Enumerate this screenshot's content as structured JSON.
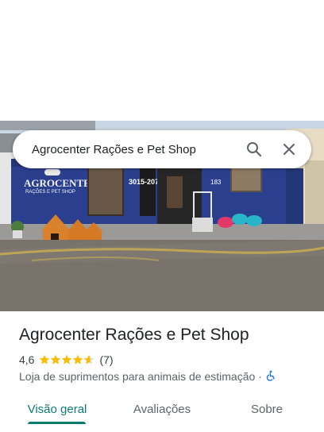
{
  "search": {
    "query": "Agrocenter Rações e Pet Shop"
  },
  "storefront": {
    "sign_brand": "AGROCENTER",
    "sign_sub": "RAÇÕES E PET SHOP",
    "phone": "3015-2074",
    "number": "183"
  },
  "place": {
    "name": "Agrocenter Rações e Pet Shop",
    "rating": "4,6",
    "rating_value": 4.6,
    "reviews_count": "(7)",
    "category": "Loja de suprimentos para animais de estimação",
    "separator": "·"
  },
  "tabs": [
    {
      "label": "Visão geral",
      "active": true
    },
    {
      "label": "Avaliações",
      "active": false
    },
    {
      "label": "Sobre",
      "active": false
    }
  ],
  "colors": {
    "accent": "#0b7a71",
    "star": "#fbbc04",
    "wall": "#2b3f8f",
    "accessible": "#1a73e8"
  }
}
